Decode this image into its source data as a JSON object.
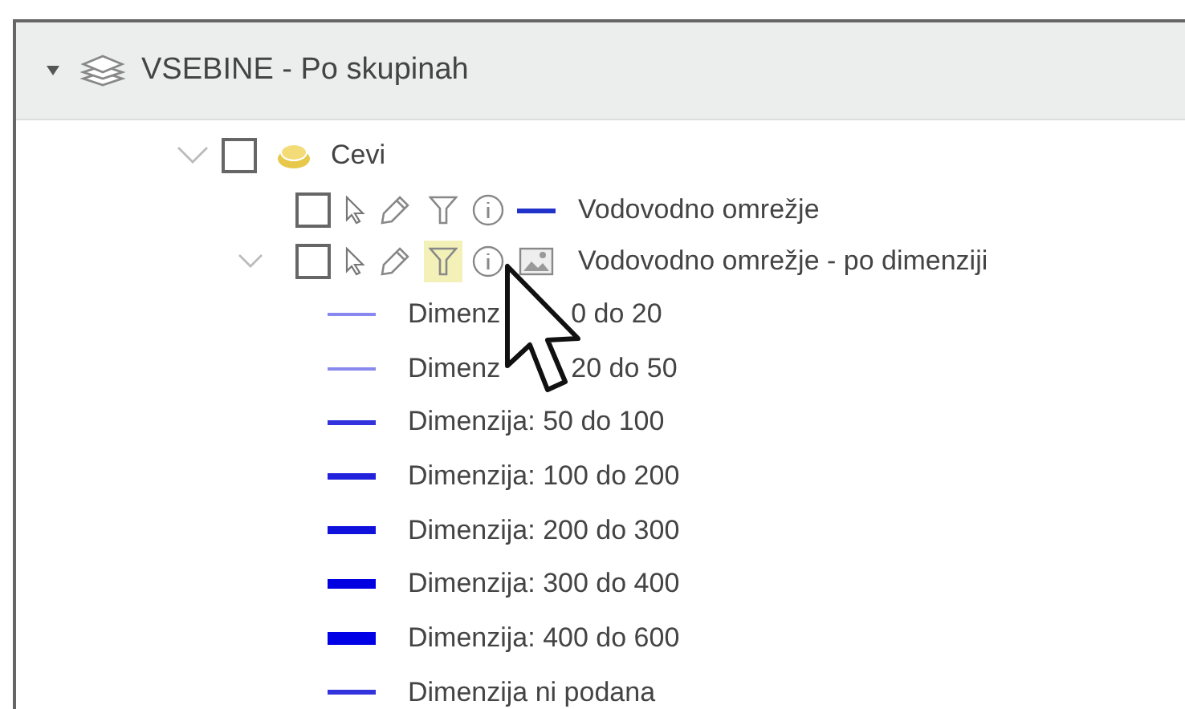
{
  "header": {
    "title": "VSEBINE - Po skupinah",
    "expanded": true
  },
  "group": {
    "name": "Cevi",
    "expanded": true,
    "checked": false
  },
  "layers": [
    {
      "name": "Vodovodno omrežje",
      "checked": false,
      "expanded": false,
      "filter_active": false,
      "kind": "line",
      "color": "#2233cc"
    },
    {
      "name": "Vodovodno omrežje - po dimenziji",
      "checked": false,
      "expanded": true,
      "filter_active": true,
      "kind": "image"
    }
  ],
  "legend": [
    {
      "parts": [
        "Dimenz",
        "0 do 20"
      ],
      "color": "#8888ee",
      "kind": "hairline"
    },
    {
      "parts": [
        "Dimenz",
        "20 do 50"
      ],
      "color": "#8888ee",
      "kind": "hairline"
    },
    {
      "parts": [
        "Dimenzija: 50 do 100"
      ],
      "color": "#3333dd",
      "kind": "fine"
    },
    {
      "parts": [
        "Dimenzija: 100 do 200"
      ],
      "color": "#2222dd",
      "kind": "regular"
    },
    {
      "parts": [
        "Dimenzija: 200 do 300"
      ],
      "color": "#1111dd",
      "kind": "medium"
    },
    {
      "parts": [
        "Dimenzija: 300 do 400"
      ],
      "color": "#0000e0",
      "kind": "heavy"
    },
    {
      "parts": [
        "Dimenzija: 400 do 600"
      ],
      "color": "#0000e6",
      "kind": "thick"
    },
    {
      "parts": [
        "Dimenzija ni podana"
      ],
      "color": "#3333dd",
      "kind": "fine"
    }
  ]
}
